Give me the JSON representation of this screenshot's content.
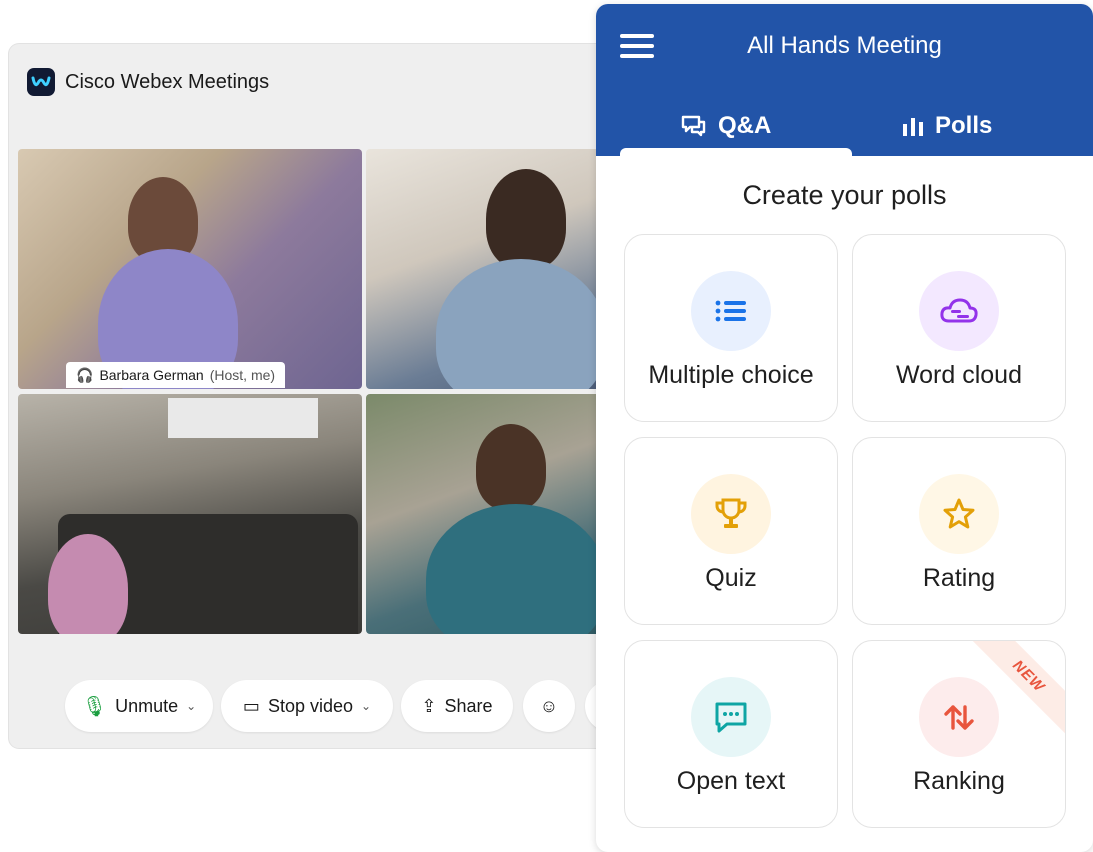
{
  "webex": {
    "title": "Cisco Webex Meetings",
    "name_tag": {
      "name": "Barbara German",
      "role": "(Host, me)"
    },
    "controls": {
      "unmute": "Unmute",
      "stop_video": "Stop video",
      "share": "Share"
    }
  },
  "panel": {
    "title": "All Hands Meeting",
    "tabs": [
      {
        "label": "Q&A",
        "icon": "chat-bubbles-icon"
      },
      {
        "label": "Polls",
        "icon": "bar-chart-icon"
      }
    ],
    "active_tab": "Q&A",
    "heading": "Create your polls",
    "cards": [
      {
        "label": "Multiple choice",
        "icon": "list-icon",
        "accent": "#1a73e8",
        "bg": "#e8f0fe"
      },
      {
        "label": "Word cloud",
        "icon": "cloud-icon",
        "accent": "#9333ea",
        "bg": "#f3e8ff"
      },
      {
        "label": "Quiz",
        "icon": "trophy-icon",
        "accent": "#e3a008",
        "bg": "#fff4e0"
      },
      {
        "label": "Rating",
        "icon": "star-icon",
        "accent": "#e3a008",
        "bg": "#fff7e6"
      },
      {
        "label": "Open text",
        "icon": "message-icon",
        "accent": "#0ea5a4",
        "bg": "#e6f6f7"
      },
      {
        "label": "Ranking",
        "icon": "sort-arrows-icon",
        "accent": "#e8553d",
        "bg": "#fdecec",
        "badge": "NEW"
      }
    ],
    "header_color": "#2254a8"
  }
}
